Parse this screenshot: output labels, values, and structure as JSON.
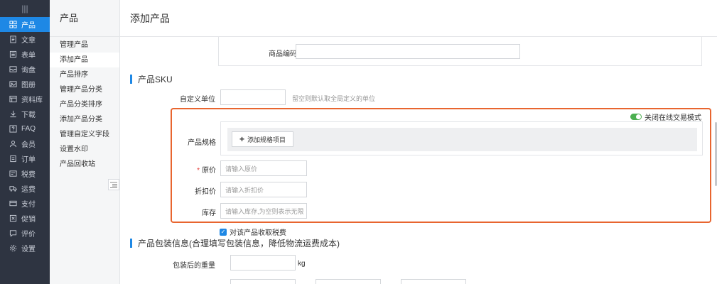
{
  "nav": {
    "top_icon": "|||",
    "items": [
      {
        "label": "产品",
        "icon": "grid-icon"
      },
      {
        "label": "文章",
        "icon": "document-icon"
      },
      {
        "label": "表单",
        "icon": "form-icon"
      },
      {
        "label": "询盘",
        "icon": "inbox-icon"
      },
      {
        "label": "图册",
        "icon": "album-icon"
      },
      {
        "label": "资料库",
        "icon": "library-icon"
      },
      {
        "label": "下载",
        "icon": "download-icon"
      },
      {
        "label": "FAQ",
        "icon": "question-icon"
      },
      {
        "label": "会员",
        "icon": "member-icon"
      },
      {
        "label": "订单",
        "icon": "order-icon"
      },
      {
        "label": "税费",
        "icon": "tax-icon"
      },
      {
        "label": "运费",
        "icon": "truck-icon"
      },
      {
        "label": "支付",
        "icon": "payment-icon"
      },
      {
        "label": "促销",
        "icon": "promotion-icon"
      },
      {
        "label": "评价",
        "icon": "comment-icon"
      },
      {
        "label": "设置",
        "icon": "gear-icon"
      }
    ],
    "active_index": 0
  },
  "sub": {
    "title": "产品",
    "items": [
      "管理产品",
      "添加产品",
      "产品排序",
      "管理产品分类",
      "产品分类排序",
      "添加产品分类",
      "管理自定义字段",
      "设置水印",
      "产品回收站"
    ],
    "active_index": 1
  },
  "page": {
    "title": "添加产品"
  },
  "code": {
    "label": "商品编码",
    "value": ""
  },
  "sku": {
    "title": "产品SKU",
    "unit_label": "自定义单位",
    "unit_value": "",
    "unit_hint": "留空则默认取全局定义的单位",
    "toggle_label": "关闭在线交易模式",
    "spec_label": "产品规格",
    "add_spec_label": "添加规格项目",
    "price_label": "原价",
    "price_placeholder": "请输入原价",
    "discount_label": "折扣价",
    "discount_placeholder": "请输入折扣价",
    "stock_label": "库存",
    "stock_placeholder": "请输入库存,为空则表示无限",
    "tax_label": "对该产品收取税费",
    "tax_checked": true
  },
  "package": {
    "title": "产品包装信息(合理填写包装信息，降低物流运费成本)",
    "weight_label": "包装后的重量",
    "weight_unit": "kg"
  },
  "colors": {
    "accent": "#1e88e5",
    "highlight": "#e8652f",
    "toggle": "#4caf50",
    "nav_bg": "#2e3441"
  }
}
